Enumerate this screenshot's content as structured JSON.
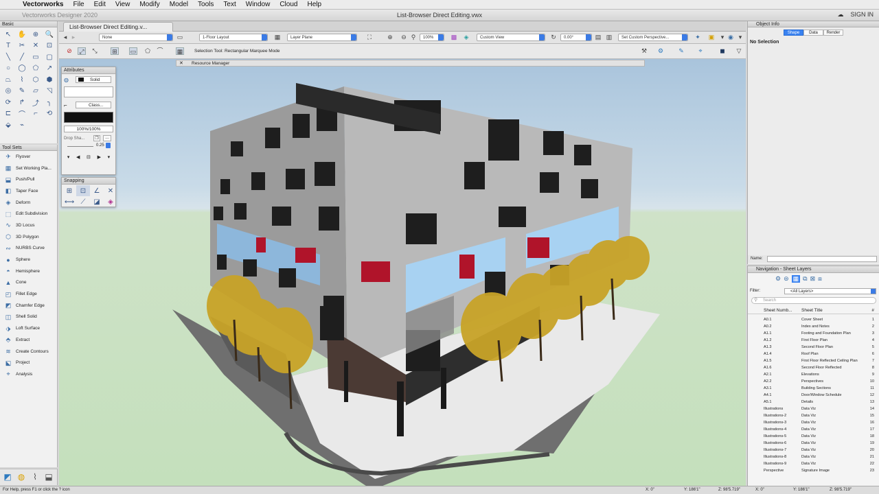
{
  "menubar": {
    "app": "Vectorworks",
    "items": [
      "File",
      "Edit",
      "View",
      "Modify",
      "Model",
      "Tools",
      "Text",
      "Window",
      "Cloud",
      "Help"
    ]
  },
  "window": {
    "app_title": "Vectorworks Designer 2020",
    "doc_title": "List-Browser Direct Editing.vwx",
    "sign_in": "SIGN IN"
  },
  "doc_tab": {
    "label": "List-Browser Direct Editing.v..."
  },
  "view_bar": {
    "class": "None",
    "layer": "1-Floor Layout",
    "plane": "Layer Plane",
    "zoom": "100%",
    "view": "Custom View",
    "angle": "0.00°",
    "perspective": "Set Custom Perspective..."
  },
  "mode_bar": {
    "message": "Selection Tool: Rectangular Marquee Mode"
  },
  "resource_manager": {
    "title": "Resource Manager"
  },
  "basic_palette": {
    "title": "Basic",
    "tools": [
      "↖",
      "✋",
      "⊕",
      "🔍",
      "T",
      "✂",
      "✕",
      "⊡",
      "╲",
      "╱",
      "▭",
      "▢",
      "○",
      "◯",
      "⬠",
      "↗",
      "⏢",
      "⌇",
      "⬡",
      "⬢",
      "◎",
      "✎",
      "▱",
      "◹",
      "⟳",
      "↱",
      "⤴",
      "╮",
      "⊏",
      "⌒",
      "⌐",
      "⟲",
      "⬙",
      "⌁"
    ]
  },
  "attributes": {
    "title": "Attributes",
    "fill": "Solid",
    "pen": "Class...",
    "opacity": "100%/100%",
    "drop_shadow": "Drop Sha...",
    "thickness": "0.25"
  },
  "snapping": {
    "title": "Snapping"
  },
  "tool_sets": {
    "title": "Tool Sets",
    "items": [
      {
        "icon": "✈",
        "label": "Flyover"
      },
      {
        "icon": "▦",
        "label": "Set Working Pla..."
      },
      {
        "icon": "⬓",
        "label": "Push/Pull"
      },
      {
        "icon": "◧",
        "label": "Taper Face"
      },
      {
        "icon": "◈",
        "label": "Deform"
      },
      {
        "icon": "⬚",
        "label": "Edit Subdivision"
      },
      {
        "icon": "∿",
        "label": "3D Locus"
      },
      {
        "icon": "⬡",
        "label": "3D Polygon"
      },
      {
        "icon": "∾",
        "label": "NURBS Curve"
      },
      {
        "icon": "●",
        "label": "Sphere"
      },
      {
        "icon": "◓",
        "label": "Hemisphere"
      },
      {
        "icon": "▲",
        "label": "Cone"
      },
      {
        "icon": "◰",
        "label": "Fillet Edge"
      },
      {
        "icon": "◩",
        "label": "Chamfer Edge"
      },
      {
        "icon": "◫",
        "label": "Shell Solid"
      },
      {
        "icon": "⬗",
        "label": "Loft Surface"
      },
      {
        "icon": "⬘",
        "label": "Extract"
      },
      {
        "icon": "≋",
        "label": "Create Contours"
      },
      {
        "icon": "⬕",
        "label": "Project"
      },
      {
        "icon": "⌖",
        "label": "Analysis"
      }
    ]
  },
  "object_info": {
    "title": "Object Info",
    "tabs": [
      "Shape",
      "Data",
      "Render"
    ],
    "active_tab": "Shape",
    "selection": "No Selection",
    "name_label": "Name:"
  },
  "navigation": {
    "title": "Navigation - Sheet Layers",
    "filter_label": "Filter:",
    "filter_value": "<All Layers>",
    "search_placeholder": "Search",
    "columns": [
      "Sheet Numb...",
      "Sheet Title",
      "#"
    ],
    "rows": [
      {
        "num": "A0.1",
        "title": "Cover Sheet",
        "n": "1"
      },
      {
        "num": "A0.2",
        "title": "Index and Notes",
        "n": "2"
      },
      {
        "num": "A1.1",
        "title": "Footing and Foundation Plan",
        "n": "3"
      },
      {
        "num": "A1.2",
        "title": "First Floor Plan",
        "n": "4"
      },
      {
        "num": "A1.3",
        "title": "Second Floor Plan",
        "n": "5"
      },
      {
        "num": "A1.4",
        "title": "Roof Plan",
        "n": "6"
      },
      {
        "num": "A1.5",
        "title": "First Floor Reflected Ceiling Plan",
        "n": "7"
      },
      {
        "num": "A1.6",
        "title": "Second Floor Reflected",
        "n": "8"
      },
      {
        "num": "A2.1",
        "title": "Elevations",
        "n": "9"
      },
      {
        "num": "A2.2",
        "title": "Perspectives",
        "n": "10"
      },
      {
        "num": "A3.1",
        "title": "Building Sections",
        "n": "11"
      },
      {
        "num": "A4.1",
        "title": "Door/Window Schedule",
        "n": "12"
      },
      {
        "num": "A5.1",
        "title": "Details",
        "n": "13"
      },
      {
        "num": "Illustrations",
        "title": "Data Viz",
        "n": "14"
      },
      {
        "num": "Illustrations-2",
        "title": "Data Viz",
        "n": "15"
      },
      {
        "num": "Illustrations-3",
        "title": "Data Viz",
        "n": "16"
      },
      {
        "num": "Illustrations-4",
        "title": "Data Viz",
        "n": "17"
      },
      {
        "num": "Illustrations-5",
        "title": "Data Viz",
        "n": "18"
      },
      {
        "num": "Illustrations-6",
        "title": "Data Viz",
        "n": "19"
      },
      {
        "num": "Illustrations-7",
        "title": "Data Viz",
        "n": "20"
      },
      {
        "num": "Illustrations-8",
        "title": "Data Viz",
        "n": "21"
      },
      {
        "num": "Illustrations-9",
        "title": "Data Viz",
        "n": "22"
      },
      {
        "num": "Perspective",
        "title": "Signature Image",
        "n": "23"
      }
    ]
  },
  "status": {
    "help": "For Help, press F1 or click the ? icon",
    "coords": [
      "X: 0\"",
      "Y: 186'1\"",
      "Z: 98'5.719\"",
      "X: 0\"",
      "Y: 186'1\"",
      "Z: 98'5.719\""
    ]
  },
  "colors": {
    "accent": "#3a82f0",
    "facade_grey": "#b9b9b9",
    "facade_dark": "#7c7c7c",
    "glass_blue": "#a8d2f2",
    "window_red": "#b0142a",
    "tree_yellow": "#c8a328",
    "ground_green": "#c4e0bc"
  }
}
